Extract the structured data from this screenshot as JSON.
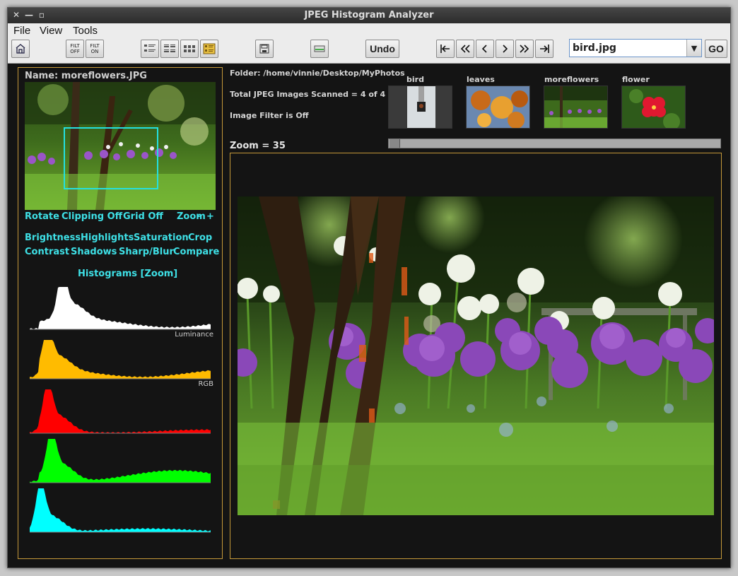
{
  "window": {
    "title": "JPEG Histogram Analyzer"
  },
  "menu": [
    "File",
    "View",
    "Tools"
  ],
  "toolbar": {
    "filt_off": [
      "FILT",
      "OFF"
    ],
    "filt_on": [
      "FILT",
      "ON"
    ],
    "undo": "Undo",
    "file_value": "bird.jpg",
    "go": "GO",
    "icons": [
      "home-icon",
      "filter-off-icon",
      "filter-on-icon",
      "layout-a-icon",
      "layout-b-icon",
      "layout-c-icon",
      "layout-d-icon",
      "save-icon",
      "scanner-icon",
      "first-icon",
      "prev-fast-icon",
      "prev-icon",
      "next-icon",
      "next-fast-icon",
      "last-icon"
    ]
  },
  "left": {
    "name": "Name: moreflowers.JPG",
    "tools_row1": [
      "Rotate",
      "Clipping Off",
      "Grid Off",
      "Zoom",
      "-",
      "+"
    ],
    "tools_row2": [
      "Brightness",
      "Highlights",
      "Saturation",
      "Crop"
    ],
    "tools_row3": [
      "Contrast",
      "Shadows",
      "Sharp/Blur",
      "Compare"
    ],
    "histograms_title": "Histograms [Zoom]",
    "histograms": [
      {
        "label": "Luminance",
        "color": "#ffffff"
      },
      {
        "label": "RGB",
        "color": "#ffbb00"
      },
      {
        "label": "",
        "color": "#ff0000"
      },
      {
        "label": "",
        "color": "#00ff00"
      },
      {
        "label": "",
        "color": "#00ffff"
      }
    ]
  },
  "info": {
    "folder": "Folder: /home/vinnie/Desktop/MyPhotos",
    "scanned": "Total JPEG Images Scanned = 4 of 4",
    "filter": "Image Filter is Off"
  },
  "thumbs": [
    "bird",
    "leaves",
    "moreflowers",
    "flower"
  ],
  "zoom": {
    "label": "Zoom = 35",
    "value": 35
  }
}
